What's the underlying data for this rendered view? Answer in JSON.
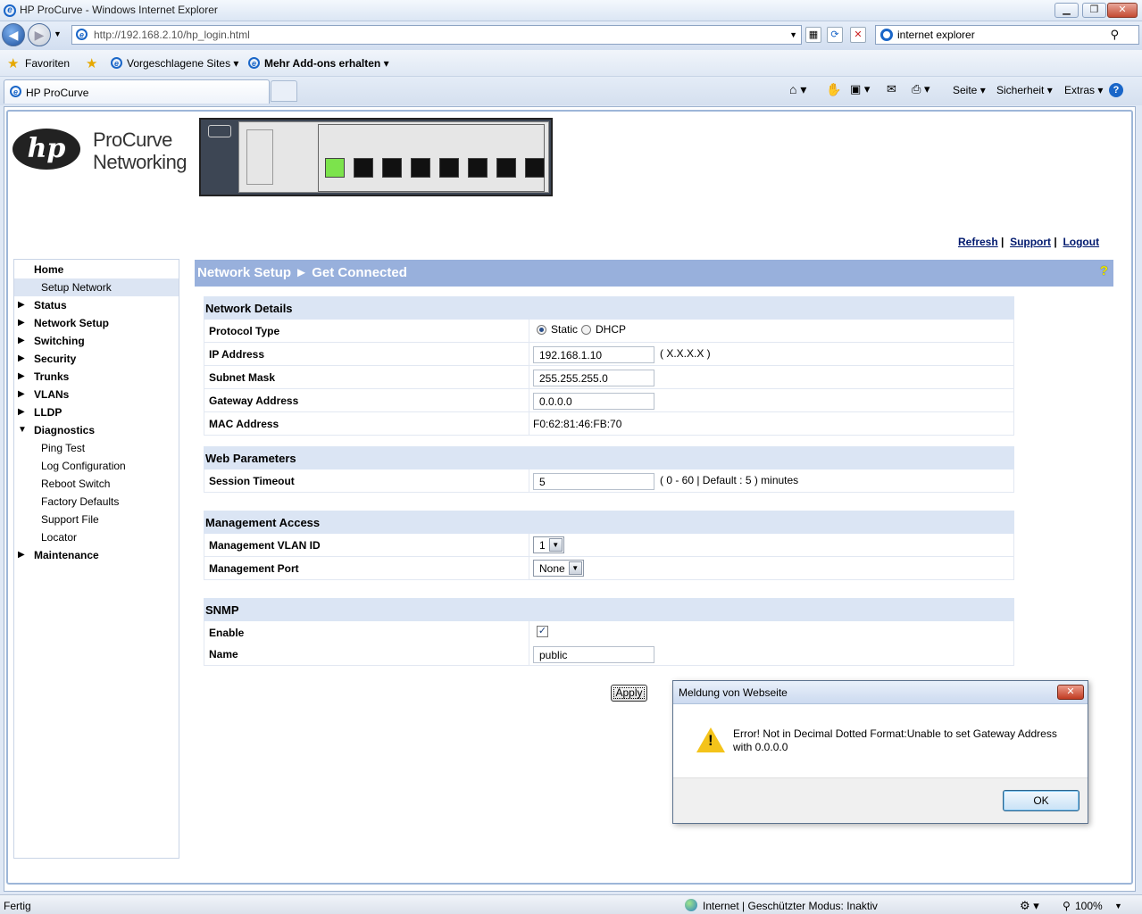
{
  "window": {
    "title": "HP ProCurve - Windows Internet Explorer"
  },
  "browser": {
    "url": "http://192.168.2.10/hp_login.html",
    "search_query": "internet explorer",
    "favorites_label": "Favoriten",
    "suggested_sites": "Vorgeschlagene Sites",
    "addons": "Mehr Add-ons erhalten",
    "tab_title": "HP ProCurve",
    "commands": {
      "page": "Seite",
      "security": "Sicherheit",
      "extras": "Extras"
    },
    "status": {
      "left": "Fertig",
      "zone": "Internet | Geschützter Modus: Inaktiv",
      "zoom": "100%"
    }
  },
  "brand": {
    "logo_text": "hp",
    "line1": "ProCurve",
    "line2": "Networking"
  },
  "toplinks": {
    "refresh": "Refresh",
    "support": "Support",
    "logout": "Logout",
    "sep": "|"
  },
  "sidebar": {
    "items": [
      {
        "label": "Home"
      },
      {
        "label": "Setup Network"
      },
      {
        "label": "Status"
      },
      {
        "label": "Network Setup"
      },
      {
        "label": "Switching"
      },
      {
        "label": "Security"
      },
      {
        "label": "Trunks"
      },
      {
        "label": "VLANs"
      },
      {
        "label": "LLDP"
      },
      {
        "label": "Diagnostics"
      },
      {
        "label": "Ping Test"
      },
      {
        "label": "Log Configuration"
      },
      {
        "label": "Reboot Switch"
      },
      {
        "label": "Factory Defaults"
      },
      {
        "label": "Support File"
      },
      {
        "label": "Locator"
      },
      {
        "label": "Maintenance"
      }
    ]
  },
  "header": {
    "title": "Network Setup ► Get Connected",
    "help": "?"
  },
  "network_details": {
    "title": "Network Details",
    "protocol_label": "Protocol Type",
    "static_label": "Static",
    "dhcp_label": "DHCP",
    "ip_label": "IP Address",
    "ip_value": "192.168.1.10",
    "ip_hint": "( X.X.X.X )",
    "subnet_label": "Subnet Mask",
    "subnet_value": "255.255.255.0",
    "gateway_label": "Gateway Address",
    "gateway_value": "0.0.0.0",
    "mac_label": "MAC Address",
    "mac_value": "F0:62:81:46:FB:70"
  },
  "web_params": {
    "title": "Web Parameters",
    "timeout_label": "Session Timeout",
    "timeout_value": "5",
    "timeout_hint": "( 0 - 60 | Default : 5 ) minutes"
  },
  "mgmt": {
    "title": "Management Access",
    "vlan_label": "Management VLAN ID",
    "vlan_value": "1",
    "port_label": "Management Port",
    "port_value": "None"
  },
  "snmp": {
    "title": "SNMP",
    "enable_label": "Enable",
    "name_label": "Name",
    "name_value": "public"
  },
  "apply_label": "Apply",
  "dialog": {
    "title": "Meldung von Webseite",
    "message": "Error! Not in Decimal Dotted Format:Unable to set Gateway Address with 0.0.0.0",
    "ok_label": "OK"
  }
}
